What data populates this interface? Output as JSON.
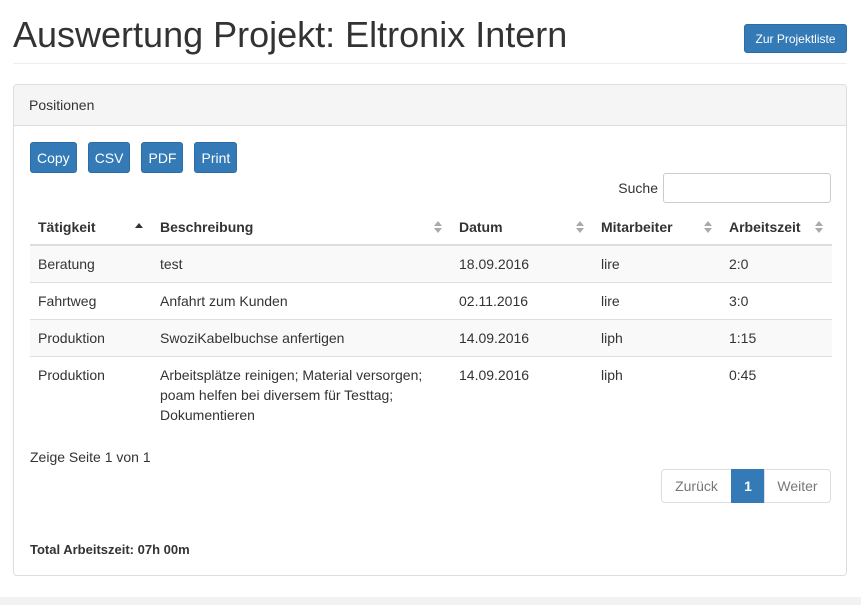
{
  "header": {
    "title": "Auswertung Projekt: Eltronix Intern",
    "back_button": "Zur Projektliste"
  },
  "panel": {
    "heading": "Positionen"
  },
  "export_buttons": [
    "Copy",
    "CSV",
    "PDF",
    "Print"
  ],
  "search": {
    "label": "Suche",
    "value": ""
  },
  "table": {
    "columns": [
      "Tätigkeit",
      "Beschreibung",
      "Datum",
      "Mitarbeiter",
      "Arbeitszeit"
    ],
    "sorted_column": "Tätigkeit",
    "sort_direction": "asc",
    "rows": [
      [
        "Beratung",
        "test",
        "18.09.2016",
        "lire",
        "2:0"
      ],
      [
        "Fahrtweg",
        "Anfahrt zum Kunden",
        "02.11.2016",
        "lire",
        "3:0"
      ],
      [
        "Produktion",
        "SwoziKabelbuchse anfertigen",
        "14.09.2016",
        "liph",
        "1:15"
      ],
      [
        "Produktion",
        "Arbeitsplätze reinigen; Material versorgen; poam helfen bei diversem für Testtag; Dokumentieren",
        "14.09.2016",
        "liph",
        "0:45"
      ]
    ]
  },
  "info": "Zeige Seite 1 von 1",
  "pagination": {
    "previous": "Zurück",
    "current": "1",
    "next": "Weiter"
  },
  "total": "Total Arbeitszeit: 07h 00m",
  "colors": {
    "primary": "#337ab7",
    "border": "#ddd",
    "panel_heading_bg": "#f5f5f5"
  }
}
